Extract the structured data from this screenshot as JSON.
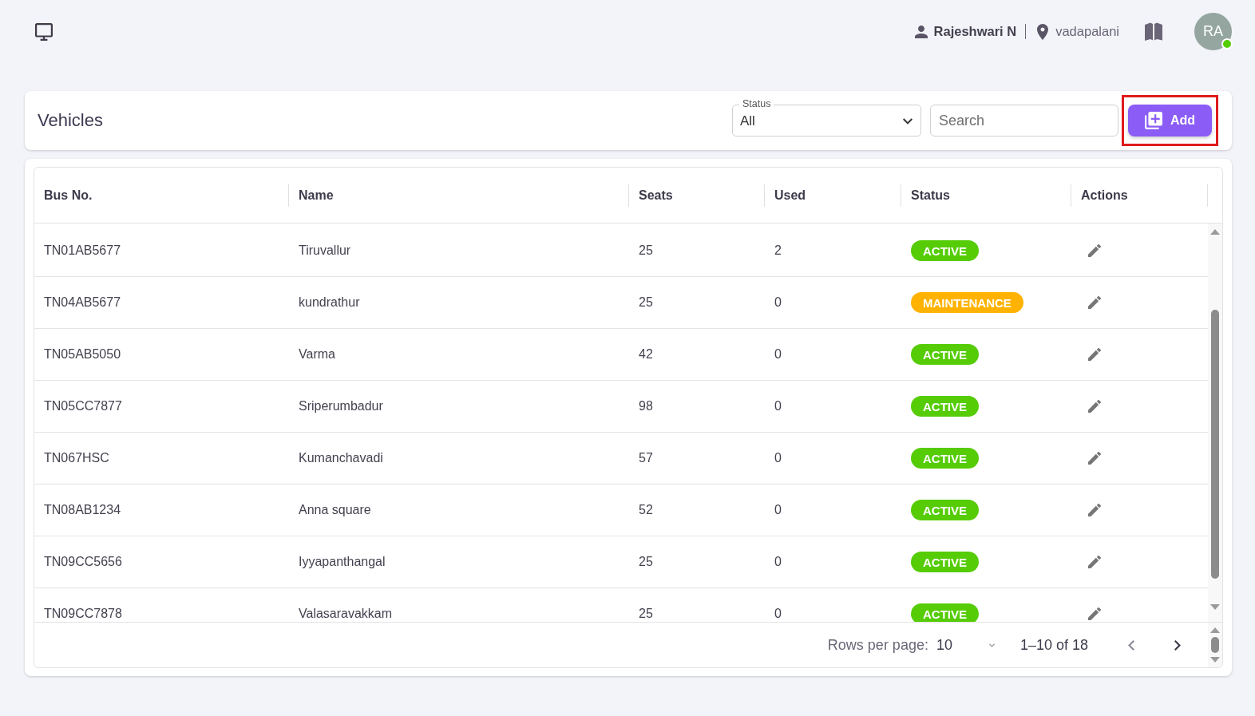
{
  "top_bar": {
    "user_name": "Rajeshwari N",
    "location": "vadapalani",
    "avatar": {
      "initials": "RA",
      "online": true
    }
  },
  "header": {
    "title": "Vehicles",
    "status_filter": {
      "label": "Status",
      "value": "All"
    },
    "search": {
      "placeholder": "Search"
    },
    "add_button": {
      "label": "Add",
      "highlighted": true
    }
  },
  "table": {
    "columns": [
      "Bus No.",
      "Name",
      "Seats",
      "Used",
      "Status",
      "Actions"
    ],
    "rows": [
      {
        "bus_no": "TN01AB5677",
        "name": "Tiruvallur",
        "seats": "25",
        "used": "2",
        "status": {
          "label": "ACTIVE",
          "color": "#55cc06"
        }
      },
      {
        "bus_no": "TN04AB5677",
        "name": "kundrathur",
        "seats": "25",
        "used": "0",
        "status": {
          "label": "MAINTENANCE",
          "color": "#ffb300"
        }
      },
      {
        "bus_no": "TN05AB5050",
        "name": "Varma",
        "seats": "42",
        "used": "0",
        "status": {
          "label": "ACTIVE",
          "color": "#55cc06"
        }
      },
      {
        "bus_no": "TN05CC7877",
        "name": "Sriperumbadur",
        "seats": "98",
        "used": "0",
        "status": {
          "label": "ACTIVE",
          "color": "#55cc06"
        }
      },
      {
        "bus_no": "TN067HSC",
        "name": "Kumanchavadi",
        "seats": "57",
        "used": "0",
        "status": {
          "label": "ACTIVE",
          "color": "#55cc06"
        }
      },
      {
        "bus_no": "TN08AB1234",
        "name": "Anna square",
        "seats": "52",
        "used": "0",
        "status": {
          "label": "ACTIVE",
          "color": "#55cc06"
        }
      },
      {
        "bus_no": "TN09CC5656",
        "name": "Iyyapanthangal",
        "seats": "25",
        "used": "0",
        "status": {
          "label": "ACTIVE",
          "color": "#55cc06"
        }
      },
      {
        "bus_no": "TN09CC7878",
        "name": "Valasaravakkam",
        "seats": "25",
        "used": "0",
        "status": {
          "label": "ACTIVE",
          "color": "#55cc06"
        }
      }
    ]
  },
  "pagination": {
    "rows_per_page_label": "Rows per page:",
    "rows_per_page": "10",
    "range": "1–10 of 18",
    "prev": {
      "disabled": true
    },
    "next": {
      "disabled": false
    }
  }
}
